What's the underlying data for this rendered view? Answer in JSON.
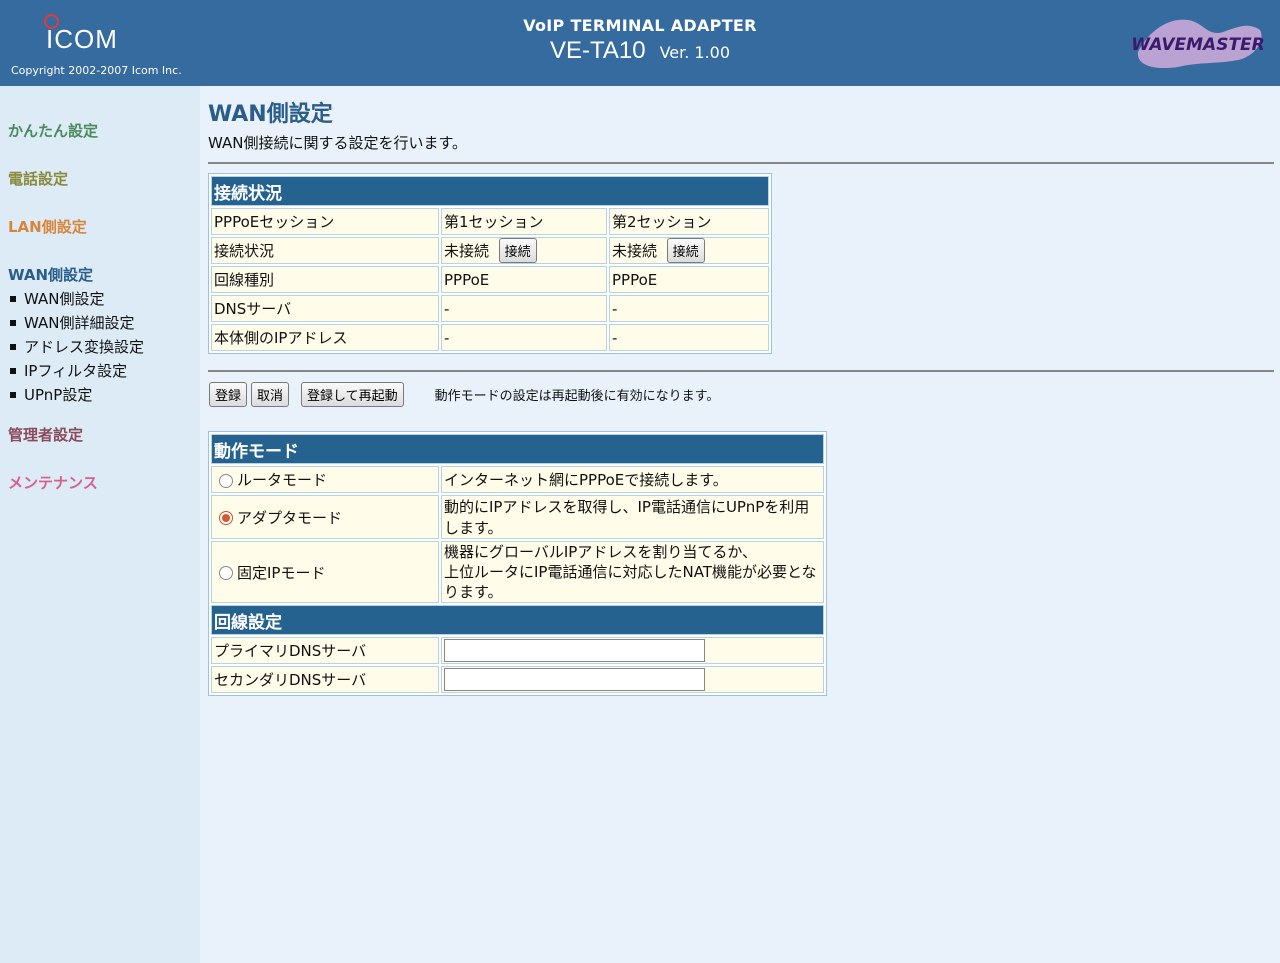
{
  "header": {
    "logo_text": "ICOM",
    "copyright": "Copyright 2002-2007 Icom Inc.",
    "product_line": "VoIP TERMINAL ADAPTER",
    "model": "VE-TA10",
    "version": "Ver. 1.00",
    "brand_logo": "WAVEMASTER"
  },
  "sidebar": {
    "cat_easy": "かんたん設定",
    "cat_phone": "電話設定",
    "cat_lan": "LAN側設定",
    "cat_wan": "WAN側設定",
    "sub_items": [
      "WAN側設定",
      "WAN側詳細設定",
      "アドレス変換設定",
      "IPフィルタ設定",
      "UPnP設定"
    ],
    "cat_admin": "管理者設定",
    "cat_maint": "メンテナンス",
    "colors": {
      "easy": "#4a8a5e",
      "phone": "#8a8a3a",
      "lan": "#d9863a",
      "wan": "#2a5d8a",
      "admin": "#8a4a5a",
      "maint": "#d9608a"
    }
  },
  "page": {
    "title": "WAN側設定",
    "description": "WAN側接続に関する設定を行います。"
  },
  "status_table": {
    "header": "接続状況",
    "rows": [
      [
        "PPPoEセッション",
        "第1セッション",
        "第2セッション"
      ],
      [
        "接続状況",
        "未接続",
        "未接続"
      ],
      [
        "回線種別",
        "PPPoE",
        "PPPoE"
      ],
      [
        "DNSサーバ",
        "-",
        "-"
      ],
      [
        "本体側のIPアドレス",
        "-",
        "-"
      ]
    ],
    "connect_label": "接続"
  },
  "actions": {
    "register": "登録",
    "cancel": "取消",
    "register_reboot": "登録して再起動",
    "note": "動作モードの設定は再起動後に有効になります。"
  },
  "mode_table": {
    "header": "動作モード",
    "modes": [
      {
        "label": "ルータモード",
        "desc": "インターネット網にPPPoEで接続します。",
        "selected": false
      },
      {
        "label": "アダプタモード",
        "desc": "動的にIPアドレスを取得し、IP電話通信にUPnPを利用します。",
        "selected": true
      },
      {
        "label": "固定IPモード",
        "desc1": "機器にグローバルIPアドレスを割り当てるか、",
        "desc2": "上位ルータにIP電話通信に対応したNAT機能が必要となります。",
        "selected": false
      }
    ]
  },
  "line_table": {
    "header": "回線設定",
    "primary_dns": "プライマリDNSサーバ",
    "secondary_dns": "セカンダリDNSサーバ",
    "primary_value": "",
    "secondary_value": ""
  }
}
